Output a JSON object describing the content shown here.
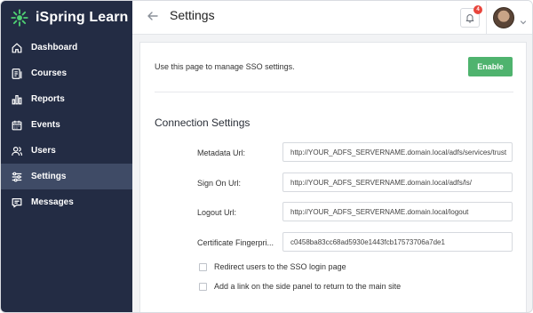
{
  "app": {
    "name": "iSpring Learn",
    "brand_color": "#4fb36e",
    "sidebar_bg": "#232c44",
    "active_item_bg": "#3f4b66"
  },
  "sidebar": {
    "items": [
      {
        "label": "Dashboard",
        "icon": "home-icon",
        "active": false
      },
      {
        "label": "Courses",
        "icon": "courses-icon",
        "active": false
      },
      {
        "label": "Reports",
        "icon": "bar-chart-icon",
        "active": false
      },
      {
        "label": "Events",
        "icon": "calendar-icon",
        "active": false
      },
      {
        "label": "Users",
        "icon": "users-icon",
        "active": false
      },
      {
        "label": "Settings",
        "icon": "sliders-icon",
        "active": true
      },
      {
        "label": "Messages",
        "icon": "message-icon",
        "active": false
      }
    ]
  },
  "header": {
    "title": "Settings",
    "notification_count": "4"
  },
  "main": {
    "intro": "Use this page to manage SSO settings.",
    "enable_label": "Enable",
    "section_title": "Connection Settings",
    "fields": [
      {
        "label": "Metadata Url:",
        "value": "http://YOUR_ADFS_SERVERNAME.domain.local/adfs/services/trust"
      },
      {
        "label": "Sign On Url:",
        "value": "http://YOUR_ADFS_SERVERNAME.domain.local/adfs/ls/"
      },
      {
        "label": "Logout Url:",
        "value": "http://YOUR_ADFS_SERVERNAME.domain.local/logout"
      },
      {
        "label": "Certificate Fingerpri...",
        "value": "c0458ba83cc68ad5930e1443fcb17573706a7de1"
      }
    ],
    "checkboxes": [
      {
        "label": "Redirect users to the SSO login page",
        "checked": false
      },
      {
        "label": "Add a link on the side panel to return to the main site",
        "checked": false
      }
    ]
  }
}
